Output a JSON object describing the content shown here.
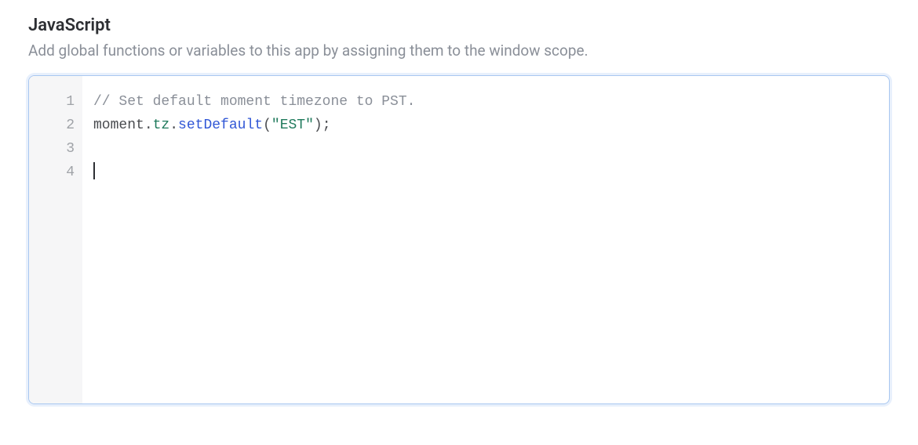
{
  "header": {
    "title": "JavaScript",
    "subtitle": "Add global functions or variables to this app by assigning them to the window scope."
  },
  "editor": {
    "line_numbers": [
      "1",
      "2",
      "3",
      "4"
    ],
    "line1_comment": "// Set default moment timezone to PST.",
    "line2": {
      "obj": "moment",
      "dot1": ".",
      "prop": "tz",
      "dot2": ".",
      "method": "setDefault",
      "open": "(",
      "str": "\"EST\"",
      "close": ")",
      "semi": ";"
    }
  }
}
